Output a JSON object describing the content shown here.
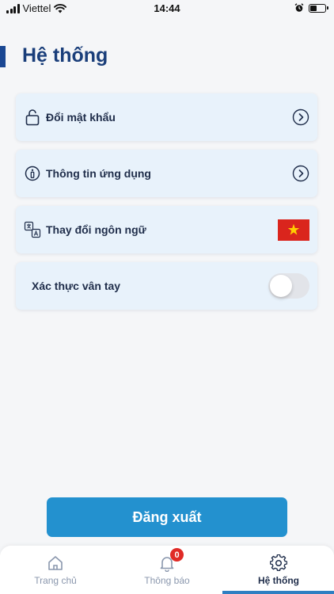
{
  "status_bar": {
    "carrier": "Viettel",
    "time": "14:44",
    "battery_level": 0.45
  },
  "header": {
    "title": "Hệ thống"
  },
  "settings": {
    "change_password": {
      "label": "Đổi mật khẩu",
      "icon": "lock-icon"
    },
    "app_info": {
      "label": "Thông tin ứng dụng",
      "icon": "info-icon"
    },
    "language": {
      "label": "Thay đổi ngôn ngữ",
      "icon": "translate-icon",
      "flag": "vietnam-flag"
    },
    "fingerprint": {
      "label": "Xác thực vân tay",
      "enabled": false
    }
  },
  "logout": {
    "label": "Đăng xuất"
  },
  "bottom_nav": {
    "items": [
      {
        "label": "Trang chủ",
        "icon": "home-icon",
        "active": false
      },
      {
        "label": "Thông báo",
        "icon": "bell-icon",
        "badge": "0",
        "active": false
      },
      {
        "label": "Hệ thống",
        "icon": "gear-icon",
        "active": true
      }
    ]
  },
  "colors": {
    "primary": "#1a3e7a",
    "button": "#2391cf",
    "card": "#e8f2fb",
    "badge": "#e02b27",
    "flag_red": "#da251d",
    "flag_star": "#ffcd00"
  }
}
